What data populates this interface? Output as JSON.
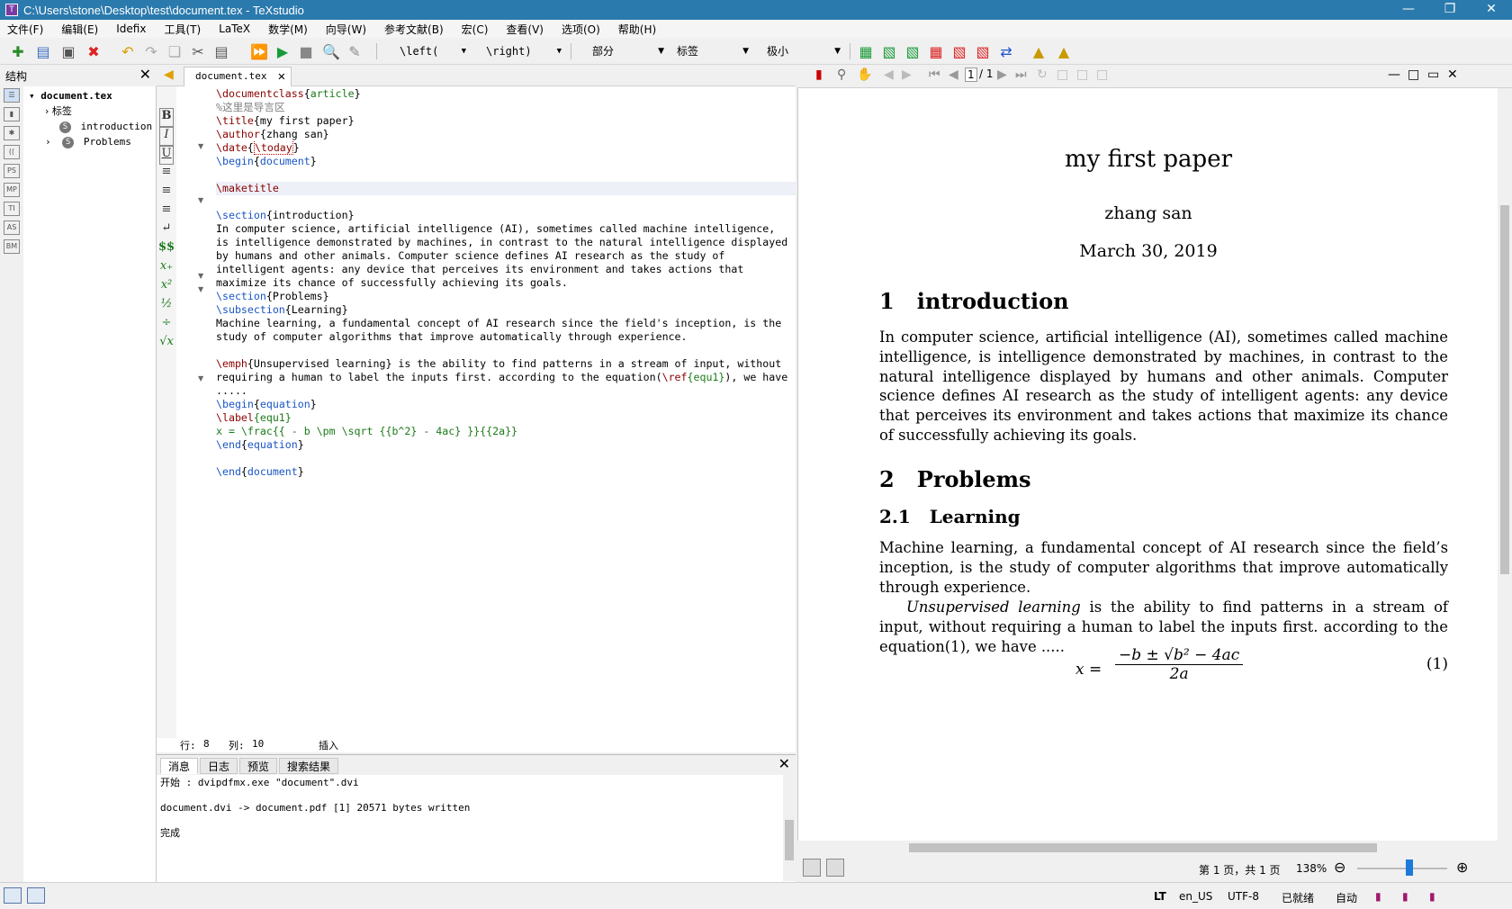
{
  "window": {
    "title": "C:\\Users\\stone\\Desktop\\test\\document.tex - TeXstudio",
    "minimize": "—",
    "restore": "❐",
    "close": "✕"
  },
  "menu": [
    "文件(F)",
    "编辑(E)",
    "Idefix",
    "工具(T)",
    "LaTeX",
    "数学(M)",
    "向导(W)",
    "参考文献(B)",
    "宏(C)",
    "查看(V)",
    "选项(O)",
    "帮助(H)"
  ],
  "toolbar": {
    "left_combo": "\\left(",
    "right_combo": "\\right)",
    "section_combo": "部分",
    "label_combo": "标签",
    "size_combo": "极小"
  },
  "structure": {
    "title": "结构",
    "root": "document.tex",
    "labels_node": "标签",
    "sections": [
      "introduction",
      "Problems"
    ]
  },
  "editor": {
    "tab": "document.tex",
    "status": {
      "row_label": "行:",
      "row": "8",
      "col_label": "列:",
      "col": "10",
      "mode": "插入"
    }
  },
  "code": {
    "l1": [
      "\\documentclass",
      "{",
      "article",
      "}"
    ],
    "l2": "%这里是导言区",
    "l3": [
      "\\title",
      "{my first paper}"
    ],
    "l4": [
      "\\author",
      "{zhang san}"
    ],
    "l5": [
      "\\date",
      "{",
      "\\today",
      "}"
    ],
    "l6": [
      "\\begin",
      "{",
      "document",
      "}"
    ],
    "l8": "\\maketitle",
    "l10": [
      "\\section",
      "{introduction}"
    ],
    "l11": "In computer science, artificial intelligence (AI), sometimes called machine intelligence,",
    "l12": "is intelligence demonstrated by machines, in contrast to the natural intelligence displayed",
    "l13": "by humans and other animals. Computer science defines AI research as the study of",
    "l14": "intelligent agents: any device that perceives its environment and takes actions that",
    "l15": "maximize its chance of successfully achieving its goals.",
    "l16": [
      "\\section",
      "{Problems}"
    ],
    "l17": [
      "\\subsection",
      "{Learning}"
    ],
    "l18": "Machine learning, a fundamental concept of AI research since the field's inception, is the",
    "l19": "study of computer algorithms that improve automatically through experience.",
    "l21a": "\\emph",
    "l21b": "{Unsupervised learning} is the ability to find patterns in a stream of input, without",
    "l22a": "requiring a human to label the inputs first. according to the equation(",
    "l22b": "\\ref",
    "l22c": "{equ1}",
    "l22d": "), we have",
    "l23": ".....",
    "l24": [
      "\\begin",
      "{",
      "equation",
      "}"
    ],
    "l25": [
      "\\label",
      "{equ1}"
    ],
    "l26": "x = \\frac{{ - b \\pm \\sqrt {{b^2} - 4ac} }}{{2a}}",
    "l27": [
      "\\end",
      "{",
      "equation",
      "}"
    ],
    "l29": [
      "\\end",
      "{",
      "document",
      "}"
    ]
  },
  "messages": {
    "tabs": [
      "消息",
      "日志",
      "预览",
      "搜索结果"
    ],
    "lines": [
      "开始 : dvipdfmx.exe \"document\".dvi",
      "document.dvi -> document.pdf [1] 20571 bytes written",
      "完成"
    ]
  },
  "pdf": {
    "page_indicator": "1",
    "page_total": "/ 1",
    "title": "my first paper",
    "author": "zhang san",
    "date": "March 30, 2019",
    "sec1_num": "1",
    "sec1": "introduction",
    "p1": "In computer science, artificial intelligence (AI), sometimes called machine intelligence, is intelligence demonstrated by machines, in contrast to the natural intelligence displayed by humans and other animals. Computer science defines AI research as the study of intelligent agents: any device that perceives its environment and takes actions that maximize its chance of successfully achieving its goals.",
    "sec2_num": "2",
    "sec2": "Problems",
    "sub_num": "2.1",
    "sub": "Learning",
    "p2": "Machine learning, a fundamental concept of AI research since the field’s inception, is the study of computer algorithms that improve automatically through experience.",
    "p3_emph": "Unsupervised learning",
    "p3": " is the ability to find patterns in a stream of input, without requiring a human to label the inputs first. according to the equation(1), we have .....",
    "eq_lhs": "x =",
    "eq_num": "−b ± √b² − 4ac",
    "eq_den": "2a",
    "eq_tag": "(1)",
    "status_pages": "第 1 页，共 1 页",
    "zoom": "138%"
  },
  "statusbar": {
    "lang": "en_US",
    "encoding": "UTF-8",
    "ready": "已就绪",
    "auto": "自动"
  }
}
